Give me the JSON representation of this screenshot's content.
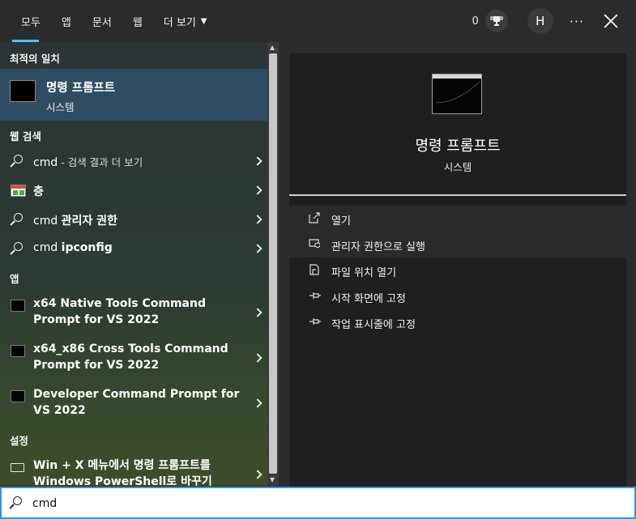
{
  "tabs": [
    {
      "label": "모두"
    },
    {
      "label": "앱"
    },
    {
      "label": "문서"
    },
    {
      "label": "웹"
    },
    {
      "label": "더 보기"
    }
  ],
  "header": {
    "points": "0",
    "avatar_letter": "H",
    "more": "···"
  },
  "sections": {
    "best_match": "최적의 일치",
    "web_search": "웹 검색",
    "apps": "앱",
    "settings": "설정"
  },
  "best_match": {
    "title": "명령 프롬프트",
    "subtitle": "시스템"
  },
  "web_results": [
    {
      "prefix": "cmd",
      "suffix": " - 검색 결과 더 보기"
    },
    {
      "prefix": "",
      "bold": "층"
    },
    {
      "prefix": "cmd ",
      "bold": "관리자 권한"
    },
    {
      "prefix": "cmd ",
      "bold": "ipconfig"
    }
  ],
  "apps": [
    {
      "line1": "x64 Native Tools Command",
      "line2": "Prompt for VS 2022"
    },
    {
      "line1": "x64_x86 Cross Tools Command",
      "line2": "Prompt for VS 2022"
    },
    {
      "line1": "Developer Command Prompt for",
      "line2": "VS 2022"
    }
  ],
  "settings": [
    {
      "line1": "Win + X 메뉴에서 명령 프롬프트를",
      "line2": "Windows PowerShell로 바꾸기"
    }
  ],
  "detail": {
    "title": "명령 프롬프트",
    "subtitle": "시스템",
    "actions": [
      {
        "label": "열기",
        "icon": "open-icon"
      },
      {
        "label": "관리자 권한으로 실행",
        "icon": "shield-icon"
      },
      {
        "label": "파일 위치 열기",
        "icon": "file-location-icon"
      },
      {
        "label": "시작 화면에 고정",
        "icon": "pin-icon"
      },
      {
        "label": "작업 표시줄에 고정",
        "icon": "pin-icon"
      }
    ]
  },
  "search": {
    "value": "cmd"
  }
}
